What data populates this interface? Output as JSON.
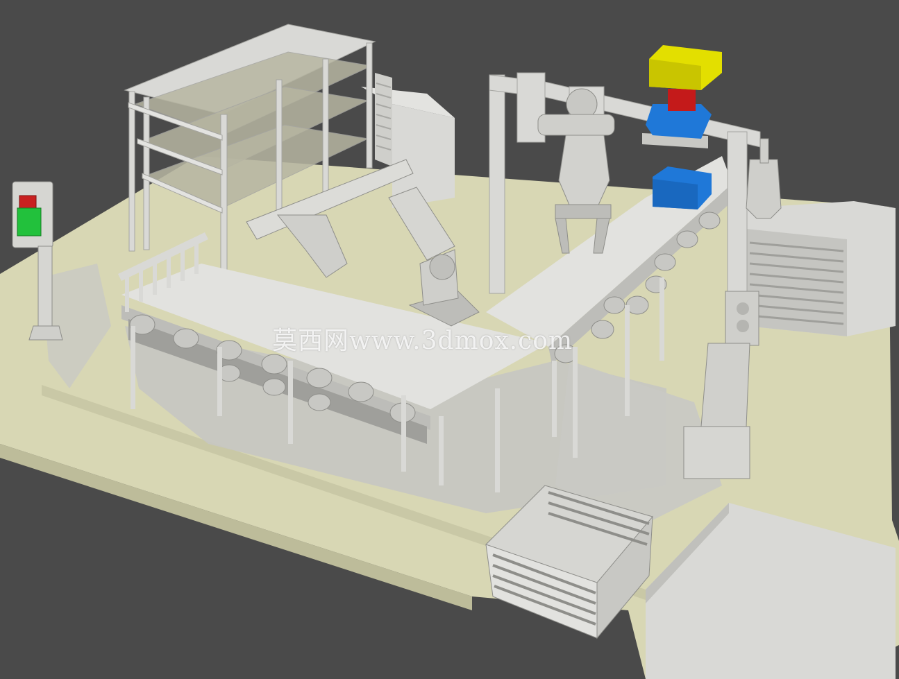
{
  "watermark": {
    "text": "莫西网www.3dmox.com"
  },
  "colors": {
    "background": "#4a4a4a",
    "floor": "#d8d7b4",
    "floor_shadow": "#c8c7a2",
    "machine": "#d9d9d6",
    "machine_dark": "#b9b9b6",
    "machine_shade": "#a8a8a4",
    "box_yellow": "#e3df00",
    "box_red": "#c41a1a",
    "box_blue": "#1f78d8",
    "signal_red": "#c82020",
    "signal_green": "#22c13c"
  }
}
